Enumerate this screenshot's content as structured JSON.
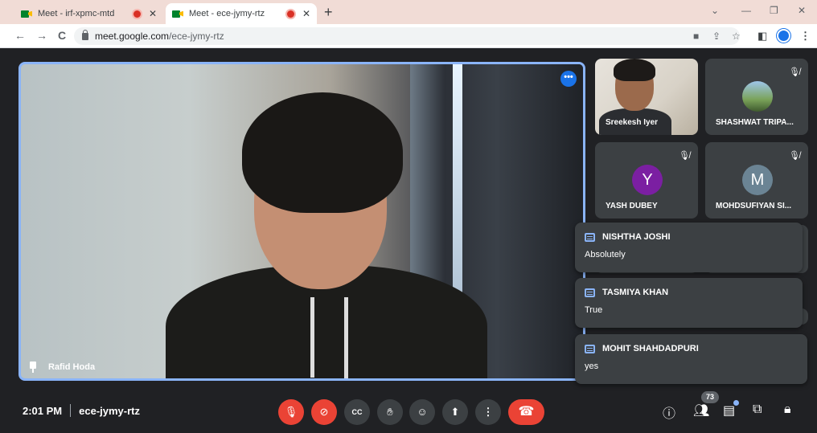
{
  "browser": {
    "tabs": [
      {
        "title": "Meet - irf-xpmc-mtd",
        "close": "✕"
      },
      {
        "title": "Meet - ece-jymy-rtz",
        "close": "✕"
      }
    ],
    "new_tab": "+",
    "url_host": "meet.google.com",
    "url_path": "/ece-jymy-rtz",
    "nav": {
      "back": "←",
      "forward": "→",
      "reload": "C"
    }
  },
  "main_tile": {
    "name": "Rafid Hoda",
    "more": "•••"
  },
  "tiles": [
    {
      "name": "Sreekesh Iyer",
      "type": "video"
    },
    {
      "name": "SHASHWAT TRIPA...",
      "type": "photo",
      "muted": true
    },
    {
      "name": "YASH DUBEY",
      "type": "letter",
      "letter": "Y",
      "color": "#7b1fa2",
      "muted": true
    },
    {
      "name": "MOHDSUFIYAN SI...",
      "type": "letter",
      "letter": "M",
      "color": "#6b8494",
      "muted": true
    }
  ],
  "chat_toasts": [
    {
      "sender": "NISHTHA JOSHI",
      "message": "Absolutely"
    },
    {
      "sender": "TASMIYA KHAN",
      "message": "True"
    },
    {
      "sender": "MOHIT SHAHDADPURI",
      "message": "yes"
    }
  ],
  "bottom_bar": {
    "time": "2:01 PM",
    "meeting_code": "ece-jymy-rtz",
    "participants_count": "73",
    "controls": {
      "mic": "mic-off-icon",
      "camera": "camera-off-icon",
      "captions": "CC",
      "hand": "hand-icon",
      "emoji": "emoji-icon",
      "present": "present-icon",
      "more": "⋮",
      "end_call": "end-call-icon"
    }
  },
  "colors": {
    "accent": "#8ab4f8",
    "red": "#ea4335",
    "tile_bg": "#3c4043",
    "stage_bg": "#202124"
  }
}
